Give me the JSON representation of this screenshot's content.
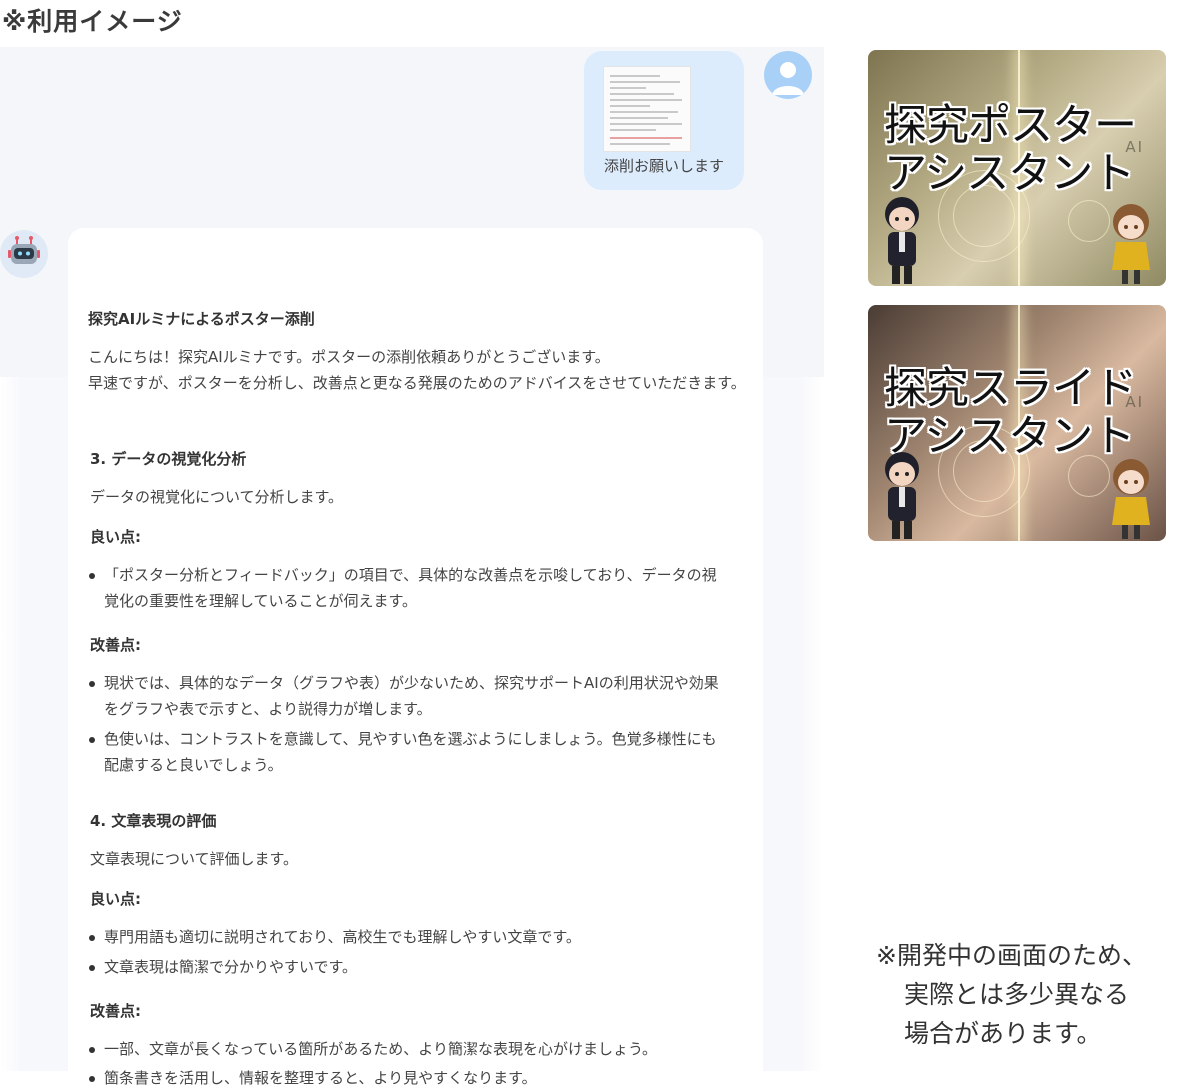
{
  "page_heading": "※利用イメージ",
  "chat": {
    "user_message": "添削お願いします",
    "bot": {
      "title": "探究AIルミナによるポスター添削",
      "intro": [
        "こんにちは！探究AIルミナです。ポスターの添削依頼ありがとうございます。",
        "早速ですが、ポスターを分析し、改善点と更なる発展のためのアドバイスをさせていただきます。"
      ],
      "section3": {
        "heading": "3.  データの視覚化分析",
        "desc": "データの視覚化について分析します。",
        "good_label": "良い点:",
        "good_items": [
          "「ポスター分析とフィードバック」の項目で、具体的な改善点を示唆しており、データの視覚化の重要性を理解していることが伺えます。"
        ],
        "improve_label": "改善点:",
        "improve_items": [
          "現状では、具体的なデータ（グラフや表）が少ないため、探究サポートAIの利用状況や効果をグラフや表で示すと、より説得力が増します。",
          "色使いは、コントラストを意識して、見やすい色を選ぶようにしましょう。色覚多様性にも配慮すると良いでしょう。"
        ]
      },
      "section4": {
        "heading": "4.  文章表現の評価",
        "desc": "文章表現について評価します。",
        "good_label": "良い点:",
        "good_items": [
          "専門用語も適切に説明されており、高校生でも理解しやすい文章です。",
          "文章表現は簡潔で分かりやすいです。"
        ],
        "improve_label": "改善点:",
        "improve_items": [
          "一部、文章が長くなっている箇所があるため、より簡潔な表現を心がけましょう。",
          "箇条書きを活用し、情報を整理すると、より見やすくなります。"
        ]
      }
    }
  },
  "banners": [
    {
      "line1": "探究ポスター",
      "line2": "アシスタント",
      "brand": "AI"
    },
    {
      "line1": "探究スライド",
      "line2": "アシスタント",
      "brand": "AI"
    }
  ],
  "note": {
    "line1": "※開発中の画面のため、",
    "line2": "実際とは多少異なる",
    "line3": "場合があります。"
  },
  "colors": {
    "user_bubble": "#dcecfc",
    "chat_background": "#f4f6fa",
    "user_avatar": "#a9d1f7"
  }
}
